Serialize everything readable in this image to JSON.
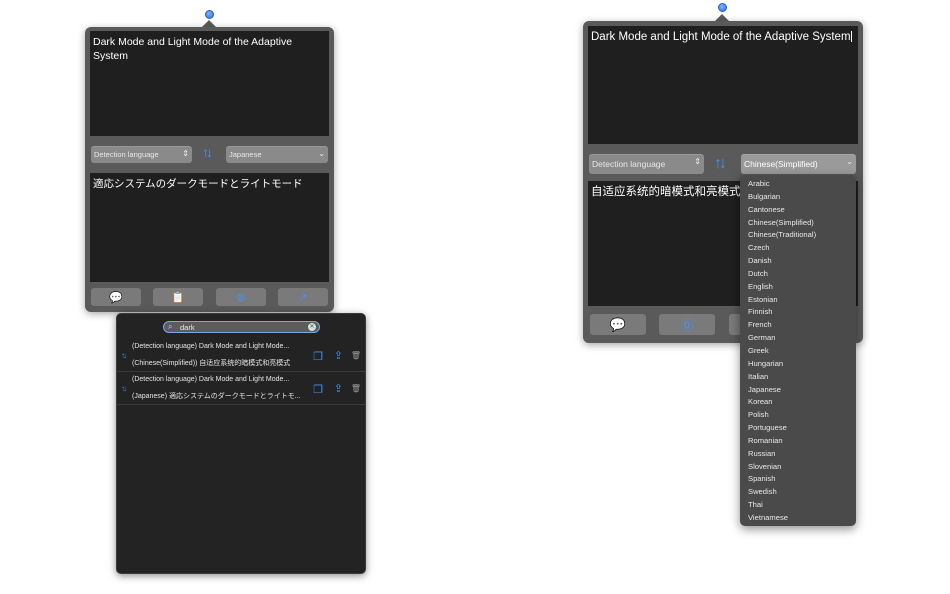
{
  "left": {
    "source_text": "Dark Mode and Light Mode of the Adaptive System",
    "source_lang": "Detection language",
    "target_lang": "Japanese",
    "translated_text": "適応システムのダークモードとライトモード",
    "toolbar": [
      "history",
      "copy",
      "translate",
      "share"
    ],
    "history": {
      "search_value": "dark",
      "entries": [
        {
          "source": "(Detection language) Dark Mode and Light Mode...",
          "translation": "(Chinese(Simplified)) 自适应系统的暗模式和亮模式"
        },
        {
          "source": "(Detection language) Dark Mode and Light Mode...",
          "translation": "(Japanese) 適応システムのダークモードとライトモ..."
        }
      ]
    }
  },
  "right": {
    "source_text": "Dark Mode and Light Mode of the Adaptive System",
    "source_lang": "Detection language",
    "target_lang": "Chinese(Simplified)",
    "translated_text": "自适应系统的暗模式和亮模式",
    "languages": [
      "Arabic",
      "Bulgarian",
      "Cantonese",
      "Chinese(Simplified)",
      "Chinese(Traditional)",
      "Czech",
      "Danish",
      "Dutch",
      "English",
      "Estonian",
      "Finnish",
      "French",
      "German",
      "Greek",
      "Hungarian",
      "Italian",
      "Japanese",
      "Korean",
      "Polish",
      "Portuguese",
      "Romanian",
      "Russian",
      "Slovenian",
      "Spanish",
      "Swedish",
      "Thai",
      "Vietnamese"
    ]
  },
  "colors": {
    "accent": "#3f92ff",
    "panel": "#5a5a5a",
    "text_area": "#1f1f1f"
  },
  "icons": {
    "swap": "swap-arrows-icon",
    "history": "speech-bubble-icon",
    "copy": "clipboard-icon",
    "translate": "compass-icon",
    "share": "share-icon",
    "search": "magnifier-icon",
    "clear": "clear-x-icon",
    "trash": "trash-icon"
  }
}
